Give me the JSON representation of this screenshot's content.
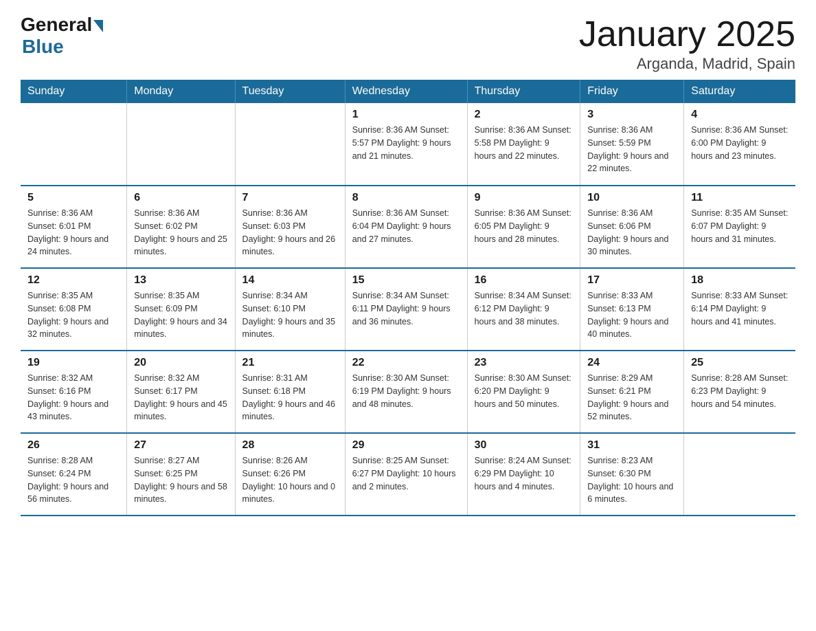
{
  "logo": {
    "general": "General",
    "blue": "Blue"
  },
  "title": "January 2025",
  "subtitle": "Arganda, Madrid, Spain",
  "days_of_week": [
    "Sunday",
    "Monday",
    "Tuesday",
    "Wednesday",
    "Thursday",
    "Friday",
    "Saturday"
  ],
  "weeks": [
    [
      {
        "day": "",
        "info": ""
      },
      {
        "day": "",
        "info": ""
      },
      {
        "day": "",
        "info": ""
      },
      {
        "day": "1",
        "info": "Sunrise: 8:36 AM\nSunset: 5:57 PM\nDaylight: 9 hours\nand 21 minutes."
      },
      {
        "day": "2",
        "info": "Sunrise: 8:36 AM\nSunset: 5:58 PM\nDaylight: 9 hours\nand 22 minutes."
      },
      {
        "day": "3",
        "info": "Sunrise: 8:36 AM\nSunset: 5:59 PM\nDaylight: 9 hours\nand 22 minutes."
      },
      {
        "day": "4",
        "info": "Sunrise: 8:36 AM\nSunset: 6:00 PM\nDaylight: 9 hours\nand 23 minutes."
      }
    ],
    [
      {
        "day": "5",
        "info": "Sunrise: 8:36 AM\nSunset: 6:01 PM\nDaylight: 9 hours\nand 24 minutes."
      },
      {
        "day": "6",
        "info": "Sunrise: 8:36 AM\nSunset: 6:02 PM\nDaylight: 9 hours\nand 25 minutes."
      },
      {
        "day": "7",
        "info": "Sunrise: 8:36 AM\nSunset: 6:03 PM\nDaylight: 9 hours\nand 26 minutes."
      },
      {
        "day": "8",
        "info": "Sunrise: 8:36 AM\nSunset: 6:04 PM\nDaylight: 9 hours\nand 27 minutes."
      },
      {
        "day": "9",
        "info": "Sunrise: 8:36 AM\nSunset: 6:05 PM\nDaylight: 9 hours\nand 28 minutes."
      },
      {
        "day": "10",
        "info": "Sunrise: 8:36 AM\nSunset: 6:06 PM\nDaylight: 9 hours\nand 30 minutes."
      },
      {
        "day": "11",
        "info": "Sunrise: 8:35 AM\nSunset: 6:07 PM\nDaylight: 9 hours\nand 31 minutes."
      }
    ],
    [
      {
        "day": "12",
        "info": "Sunrise: 8:35 AM\nSunset: 6:08 PM\nDaylight: 9 hours\nand 32 minutes."
      },
      {
        "day": "13",
        "info": "Sunrise: 8:35 AM\nSunset: 6:09 PM\nDaylight: 9 hours\nand 34 minutes."
      },
      {
        "day": "14",
        "info": "Sunrise: 8:34 AM\nSunset: 6:10 PM\nDaylight: 9 hours\nand 35 minutes."
      },
      {
        "day": "15",
        "info": "Sunrise: 8:34 AM\nSunset: 6:11 PM\nDaylight: 9 hours\nand 36 minutes."
      },
      {
        "day": "16",
        "info": "Sunrise: 8:34 AM\nSunset: 6:12 PM\nDaylight: 9 hours\nand 38 minutes."
      },
      {
        "day": "17",
        "info": "Sunrise: 8:33 AM\nSunset: 6:13 PM\nDaylight: 9 hours\nand 40 minutes."
      },
      {
        "day": "18",
        "info": "Sunrise: 8:33 AM\nSunset: 6:14 PM\nDaylight: 9 hours\nand 41 minutes."
      }
    ],
    [
      {
        "day": "19",
        "info": "Sunrise: 8:32 AM\nSunset: 6:16 PM\nDaylight: 9 hours\nand 43 minutes."
      },
      {
        "day": "20",
        "info": "Sunrise: 8:32 AM\nSunset: 6:17 PM\nDaylight: 9 hours\nand 45 minutes."
      },
      {
        "day": "21",
        "info": "Sunrise: 8:31 AM\nSunset: 6:18 PM\nDaylight: 9 hours\nand 46 minutes."
      },
      {
        "day": "22",
        "info": "Sunrise: 8:30 AM\nSunset: 6:19 PM\nDaylight: 9 hours\nand 48 minutes."
      },
      {
        "day": "23",
        "info": "Sunrise: 8:30 AM\nSunset: 6:20 PM\nDaylight: 9 hours\nand 50 minutes."
      },
      {
        "day": "24",
        "info": "Sunrise: 8:29 AM\nSunset: 6:21 PM\nDaylight: 9 hours\nand 52 minutes."
      },
      {
        "day": "25",
        "info": "Sunrise: 8:28 AM\nSunset: 6:23 PM\nDaylight: 9 hours\nand 54 minutes."
      }
    ],
    [
      {
        "day": "26",
        "info": "Sunrise: 8:28 AM\nSunset: 6:24 PM\nDaylight: 9 hours\nand 56 minutes."
      },
      {
        "day": "27",
        "info": "Sunrise: 8:27 AM\nSunset: 6:25 PM\nDaylight: 9 hours\nand 58 minutes."
      },
      {
        "day": "28",
        "info": "Sunrise: 8:26 AM\nSunset: 6:26 PM\nDaylight: 10 hours\nand 0 minutes."
      },
      {
        "day": "29",
        "info": "Sunrise: 8:25 AM\nSunset: 6:27 PM\nDaylight: 10 hours\nand 2 minutes."
      },
      {
        "day": "30",
        "info": "Sunrise: 8:24 AM\nSunset: 6:29 PM\nDaylight: 10 hours\nand 4 minutes."
      },
      {
        "day": "31",
        "info": "Sunrise: 8:23 AM\nSunset: 6:30 PM\nDaylight: 10 hours\nand 6 minutes."
      },
      {
        "day": "",
        "info": ""
      }
    ]
  ]
}
